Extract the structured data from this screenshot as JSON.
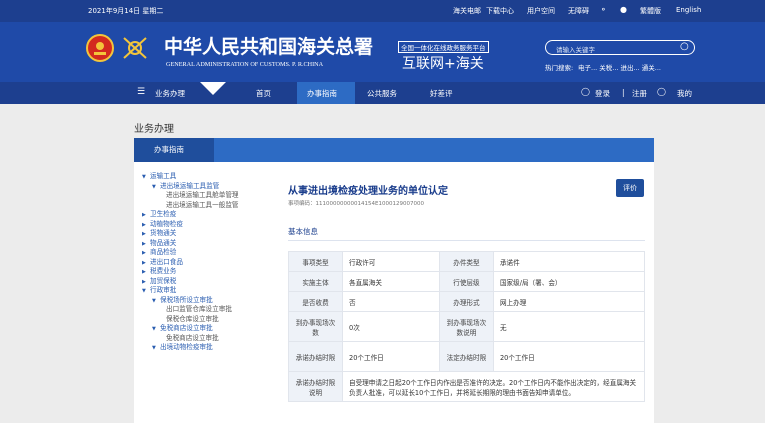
{
  "topbar": {
    "date": "2021年9月14日 星期二",
    "links": [
      "海关电邮",
      "下载中心",
      "用户空间",
      "无障碍",
      "繁體版",
      "English"
    ]
  },
  "banner": {
    "cn_title": "中华人民共和国海关总署",
    "en_title": "GENERAL ADMINISTRATION OF CUSTOMS. P. R.CHINA",
    "platform_top": "全国一体化在线政务服务平台",
    "platform_bottom": "互联网+海关",
    "search_placeholder": "请输入关键字",
    "hot_label": "热门搜索:",
    "hot_terms": "电子... 关税... 进出... 通关..."
  },
  "nav": {
    "business": "业务办理",
    "items": [
      "首页",
      "办事指南",
      "公共服务",
      "好差评"
    ],
    "login": "登录",
    "sep": "|",
    "register": "注册",
    "mine": "我的"
  },
  "page": {
    "title": "业务办理",
    "tab": "办事指南"
  },
  "tree": [
    {
      "level": 0,
      "open": true,
      "label": "运输工具"
    },
    {
      "level": 1,
      "open": true,
      "label": "进出境运输工具监管"
    },
    {
      "level": 2,
      "label": "进出境运输工具舱单管理"
    },
    {
      "level": 2,
      "label": "进出境运输工具一般监管"
    },
    {
      "level": 0,
      "open": false,
      "label": "卫生检疫"
    },
    {
      "level": 0,
      "open": false,
      "label": "动植物检疫"
    },
    {
      "level": 0,
      "open": false,
      "label": "货物通关"
    },
    {
      "level": 0,
      "open": false,
      "label": "物品通关"
    },
    {
      "level": 0,
      "open": false,
      "label": "商品检验"
    },
    {
      "level": 0,
      "open": false,
      "label": "进出口食品"
    },
    {
      "level": 0,
      "open": false,
      "label": "税费业务"
    },
    {
      "level": 0,
      "open": false,
      "label": "加贸保税"
    },
    {
      "level": 0,
      "open": true,
      "label": "行政审批"
    },
    {
      "level": 1,
      "open": true,
      "label": "保税场所设立审批"
    },
    {
      "level": 2,
      "label": "出口监管仓库设立审批"
    },
    {
      "level": 2,
      "label": "保税仓库设立审批"
    },
    {
      "level": 1,
      "open": true,
      "label": "免税商店设立审批"
    },
    {
      "level": 2,
      "label": "免税商店设立审批"
    },
    {
      "level": 1,
      "open": true,
      "label": "出境动物检疫审批"
    }
  ],
  "detail": {
    "title": "从事进出境检疫处理业务的单位认定",
    "code": "事项编码：11100000000014154E1000129007000",
    "evaluate_button": "评价",
    "section_title": "基本信息",
    "rows": [
      {
        "k1": "事项类型",
        "v1": "行政许可",
        "k2": "办件类型",
        "v2": "承诺件"
      },
      {
        "k1": "实施主体",
        "v1": "各直属海关",
        "k2": "行使层级",
        "v2": "国家级/局（署、会）"
      },
      {
        "k1": "是否收费",
        "v1": "否",
        "k2": "办理形式",
        "v2": "网上办理"
      },
      {
        "k1": "到办事现场次数",
        "v1": "0次",
        "k2": "到办事现场次数说明",
        "v2": "无"
      },
      {
        "k1": "承诺办结时限",
        "v1": "20个工作日",
        "k2": "法定办结时限",
        "v2": "20个工作日"
      }
    ],
    "note_key": "承诺办结时限说明",
    "note_value": "自受理申请之日起20个工作日内作出是否准许的决定。20个工作日内不能作出决定的，经直属海关负责人批准，可以延长10个工作日，并将延长期限的理由书面告知申请单位。"
  },
  "colors": {
    "header": "#1f4aa8",
    "nav": "#1d3f8f",
    "tab": "#2d6bc4",
    "button": "#1f4e9c"
  }
}
